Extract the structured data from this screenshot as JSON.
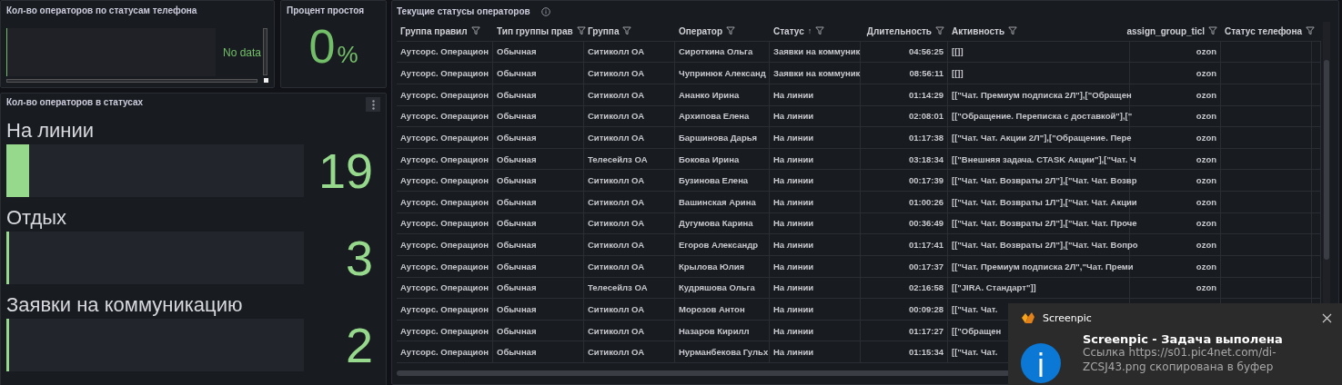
{
  "phone_status_panel": {
    "title": "Кол-во операторов по статусам телефона",
    "message": "No data"
  },
  "idle_panel": {
    "title": "Процент простоя",
    "value": "0",
    "unit": "%"
  },
  "status_panel": {
    "title": "Кол-во операторов в статусах",
    "bars": [
      {
        "label": "На линии",
        "level": 0.075,
        "value": "19"
      },
      {
        "label": "Отдых",
        "level": 0.01,
        "value": "3"
      },
      {
        "label": "Заявки на коммуникацию",
        "level": 0.01,
        "value": "2"
      }
    ]
  },
  "table": {
    "title": "Текущие статусы операторов",
    "columns": [
      {
        "label": "Группа правил"
      },
      {
        "label": "Тип группы прав"
      },
      {
        "label": "Группа"
      },
      {
        "label": "Оператор"
      },
      {
        "label": "Статус",
        "sort_icon": "↑"
      },
      {
        "label": "Длительность"
      },
      {
        "label": "Активность"
      },
      {
        "label": "assign_group_ticl"
      },
      {
        "label": "Статус телефона"
      }
    ],
    "rows": [
      [
        "Аутсорс. Операцион",
        "Обычная",
        "Ситиколл ОА",
        "Сироткина Ольга",
        "Заявки на коммуник",
        "04:56:25",
        "[[]]",
        "ozon",
        ""
      ],
      [
        "Аутсорс. Операцион",
        "Обычная",
        "Ситиколл ОА",
        "Чупринюк Александ",
        "Заявки на коммуник",
        "08:56:11",
        "[[]]",
        "ozon",
        ""
      ],
      [
        "Аутсорс. Операцион",
        "Обычная",
        "Ситиколл ОА",
        "Ананко Ирина",
        "На линии",
        "01:14:29",
        "[[\"Чат. Премиум подписка 2Л\"],[\"Обращен",
        "ozon",
        ""
      ],
      [
        "Аутсорс. Операцион",
        "Обычная",
        "Ситиколл ОА",
        "Архипова Елена",
        "На линии",
        "02:08:01",
        "[[\"Обращение. Переписка с доставкой\"],[\"",
        "ozon",
        ""
      ],
      [
        "Аутсорс. Операцион",
        "Обычная",
        "Ситиколл ОА",
        "Баршинова Дарья",
        "На линии",
        "01:17:38",
        "[[\"Чат. Чат. Акции 2Л\"],[\"Обращение. Пере",
        "ozon",
        ""
      ],
      [
        "Аутсорс. Операцион",
        "Обычная",
        "Телесейлз ОА",
        "Бокова Ирина",
        "На линии",
        "03:18:34",
        "[[\"Внешняя задача. CTASK Акции\"],[\"Чат. Ч",
        "ozon",
        ""
      ],
      [
        "Аутсорс. Операцион",
        "Обычная",
        "Ситиколл ОА",
        "Бузинова Елена",
        "На линии",
        "00:17:39",
        "[[\"Чат. Чат. Возвраты 2Л\"],[\"Чат. Чат. Возвр",
        "ozon",
        ""
      ],
      [
        "Аутсорс. Операцион",
        "Обычная",
        "Ситиколл ОА",
        "Вашинская Арина",
        "На линии",
        "01:00:26",
        "[[\"Чат. Чат. Возвраты 1Л\"],[\"Чат. Чат. Акции",
        "ozon",
        ""
      ],
      [
        "Аутсорс. Операцион",
        "Обычная",
        "Ситиколл ОА",
        "Дугумова Карина",
        "На линии",
        "00:36:49",
        "[[\"Чат. Чат. Возвраты 2Л\"],[\"Чат. Чат. Проче",
        "ozon",
        ""
      ],
      [
        "Аутсорс. Операцион",
        "Обычная",
        "Ситиколл ОА",
        "Егоров Александр",
        "На линии",
        "01:17:41",
        "[[\"Чат. Чат. Возвраты 2Л\"],[\"Чат. Чат. Вопро",
        "ozon",
        ""
      ],
      [
        "Аутсорс. Операцион",
        "Обычная",
        "Ситиколл ОА",
        "Крылова Юлия",
        "На линии",
        "00:17:37",
        "[[\"Чат. Премиум подписка 2Л\",\"Чат. Преми",
        "ozon",
        ""
      ],
      [
        "Аутсорс. Операцион",
        "Обычная",
        "Телесейлз ОА",
        "Кудряшова Ольга",
        "На линии",
        "02:16:58",
        "[[\"JIRA. Стандарт\"]]",
        "ozon",
        ""
      ],
      [
        "Аутсорс. Операцион",
        "Обычная",
        "Ситиколл ОА",
        "Морозов Антон",
        "На линии",
        "00:09:28",
        "[[\"Чат. Чат.",
        "",
        ""
      ],
      [
        "Аутсорс. Операцион",
        "Обычная",
        "Ситиколл ОА",
        "Назаров Кирилл",
        "На линии",
        "01:17:27",
        "[[\"Обращен",
        "",
        ""
      ],
      [
        "Аутсорс. Операцион",
        "Обычная",
        "Ситиколл ОА",
        "Нурманбекова Гульх",
        "На линии",
        "01:15:34",
        "[[\"Чат. Чат.",
        "",
        ""
      ]
    ]
  },
  "notification": {
    "app": "Screenpic",
    "title": "Screenpic - Задача выполена",
    "message": "Ссылка https://s01.pic4net.com/di-ZCSJ43.png скопирована в буфер"
  }
}
